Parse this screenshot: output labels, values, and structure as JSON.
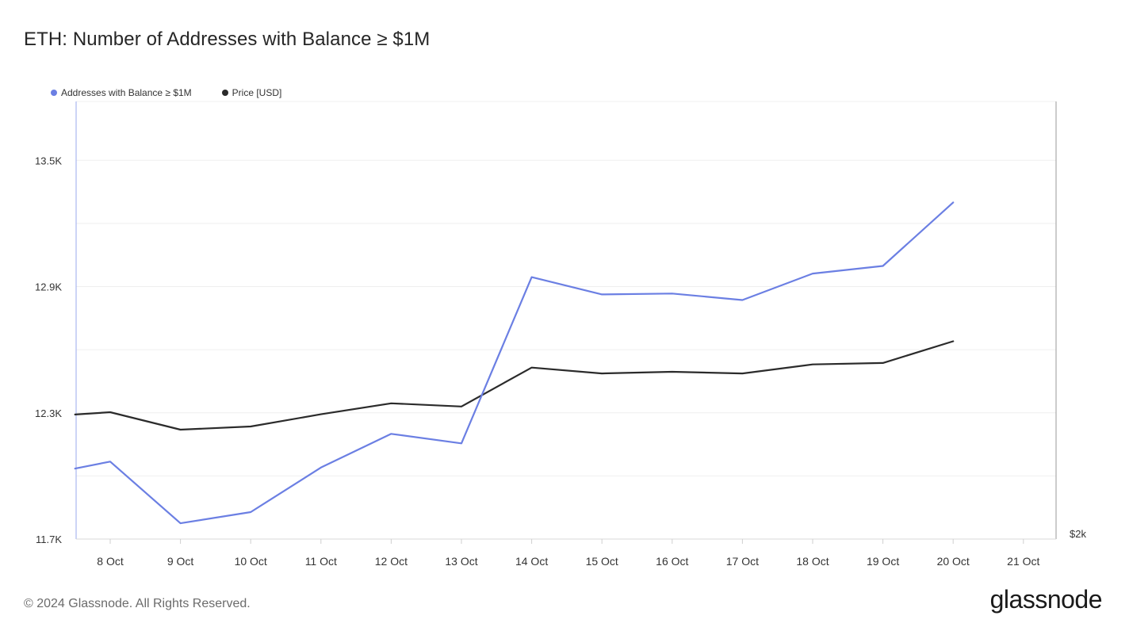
{
  "chart_data": {
    "type": "line",
    "title": "ETH: Number of Addresses with Balance ≥ $1M",
    "x": [
      "8 Oct",
      "9 Oct",
      "10 Oct",
      "11 Oct",
      "12 Oct",
      "13 Oct",
      "14 Oct",
      "15 Oct",
      "16 Oct",
      "17 Oct",
      "18 Oct",
      "19 Oct",
      "20 Oct",
      "21 Oct"
    ],
    "y_left_ticks": [
      "11.7K",
      "12.3K",
      "12.9K",
      "13.5K"
    ],
    "y_left_tick_values": [
      11700,
      12300,
      12900,
      13500
    ],
    "y_left_range": [
      11700,
      13780
    ],
    "y_right_tick_label": "$2k",
    "grid": true,
    "legend_position": "top-left",
    "series": [
      {
        "name": "Addresses with Balance ≥ $1M",
        "color": "#6b7fe3",
        "axis": "left",
        "points": [
          [
            "7 Oct 12:00",
            12035
          ],
          [
            "8 Oct",
            12068
          ],
          [
            "9 Oct",
            11775
          ],
          [
            "10 Oct",
            11828
          ],
          [
            "11 Oct",
            12040
          ],
          [
            "12 Oct",
            12200
          ],
          [
            "13 Oct",
            12155
          ],
          [
            "14 Oct",
            12945
          ],
          [
            "15 Oct",
            12863
          ],
          [
            "16 Oct",
            12867
          ],
          [
            "17 Oct",
            12836
          ],
          [
            "18 Oct",
            12962
          ],
          [
            "19 Oct",
            12998
          ],
          [
            "20 Oct",
            13300
          ]
        ]
      },
      {
        "name": "Price [USD]",
        "color": "#2b2b2b",
        "axis": "right",
        "points": [
          [
            "7 Oct 12:00",
            12292
          ],
          [
            "8 Oct",
            12303
          ],
          [
            "9 Oct",
            12220
          ],
          [
            "10 Oct",
            12235
          ],
          [
            "11 Oct",
            12293
          ],
          [
            "12 Oct",
            12345
          ],
          [
            "13 Oct",
            12330
          ],
          [
            "14 Oct",
            12515
          ],
          [
            "15 Oct",
            12487
          ],
          [
            "16 Oct",
            12495
          ],
          [
            "17 Oct",
            12487
          ],
          [
            "18 Oct",
            12530
          ],
          [
            "19 Oct",
            12537
          ],
          [
            "20 Oct",
            12640
          ]
        ]
      }
    ]
  },
  "footer": {
    "copyright": "© 2024 Glassnode. All Rights Reserved.",
    "logo_text": "glassnode"
  }
}
